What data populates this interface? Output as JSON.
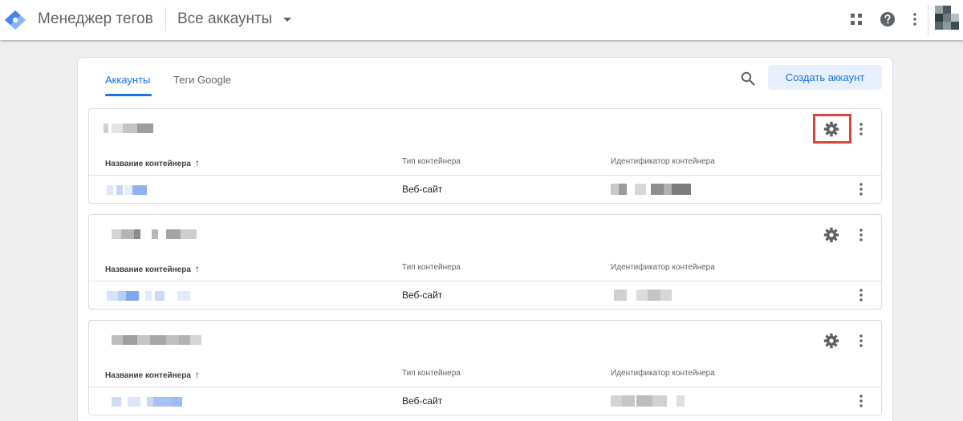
{
  "header": {
    "product_name": "Менеджер тегов",
    "account_switch_label": "Все аккаунты"
  },
  "tabs": [
    {
      "label": "Аккаунты",
      "active": true
    },
    {
      "label": "Теги Google",
      "active": false
    }
  ],
  "create_button_label": "Создать аккаунт",
  "table_headers": {
    "name": "Название контейнера",
    "type": "Тип контейнера",
    "id": "Идентификатор контейнера"
  },
  "accounts": [
    {
      "containers": [
        {
          "type": "Веб-сайт"
        }
      ],
      "settings_highlighted": true
    },
    {
      "containers": [
        {
          "type": "Веб-сайт"
        }
      ],
      "settings_highlighted": false
    },
    {
      "containers": [
        {
          "type": "Веб-сайт"
        }
      ],
      "settings_highlighted": false
    }
  ],
  "colors": {
    "accent": "#1a73e8",
    "highlight": "#d9453c",
    "background": "#eeeeee"
  },
  "icons": [
    "tag-manager-logo-icon",
    "apps-grid-icon",
    "help-icon",
    "more-vert-icon",
    "search-icon",
    "gear-icon",
    "sort-arrow-up-icon"
  ]
}
